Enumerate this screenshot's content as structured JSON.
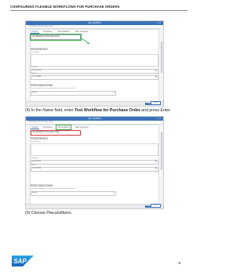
{
  "document": {
    "header_title": "CONFIGURING FLEXIBLE WORKFLOWS FOR PURCHASE ORDERS",
    "page_number": "8",
    "logo_text": "SAP",
    "colors": {
      "logo_blue": "#1a73c8",
      "highlight_green": "#38b649",
      "highlight_red": "#d9383a",
      "app_blue": "#3b73b9"
    }
  },
  "screenshot1": {
    "window_title": "New Workflow",
    "breadcrumb": "Workflows for Purchase Order",
    "tabs": [
      "Details",
      "Properties",
      "Preconditions",
      "Step Sequence"
    ],
    "active_tab": "Details",
    "name_value": "Test Workflow for Purchase Order",
    "properties_title": "PROPERTIES",
    "description_label": "Description",
    "valid_from_label": "Valid From",
    "valid_to_label": "Valid To",
    "date_from": "01.06.2019",
    "date_to": "31.12.9999",
    "preconditions_title": "PRECONDITIONS",
    "preconditions_sub": "Use start conditions to specify when the workflow can start",
    "precondition_select": "Select",
    "save_label": "Save",
    "cancel_label": "Cancel"
  },
  "caption1": {
    "prefix": "(4) In the ",
    "field_name": "Name",
    "mid": " field, enter ",
    "value": "Test Workflow for Purchase Order",
    "suffix": " and press Enter."
  },
  "screenshot2": {
    "window_title": "New Workflow",
    "breadcrumb": "Workflows for Purchase Order",
    "tabs": [
      "Details",
      "Properties",
      "Preconditions",
      "Step Sequence"
    ],
    "active_tab": "Details",
    "marked_tab": "Preconditions",
    "name_value": "Test Workflow for Purchase Order",
    "properties_title": "PROPERTIES",
    "description_label": "Description",
    "valid_from_label": "Valid From",
    "valid_to_label": "Valid To",
    "date_from": "01.06.2019",
    "date_to": "31.12.9999",
    "preconditions_title": "PRECONDITIONS",
    "preconditions_sub": "Use start conditions to specify when the workflow can start",
    "precondition_select": "Select",
    "save_label": "Save",
    "cancel_label": "Cancel"
  },
  "caption2": {
    "prefix": "(5) Choose ",
    "target": "Preconditions",
    "suffix": "."
  }
}
